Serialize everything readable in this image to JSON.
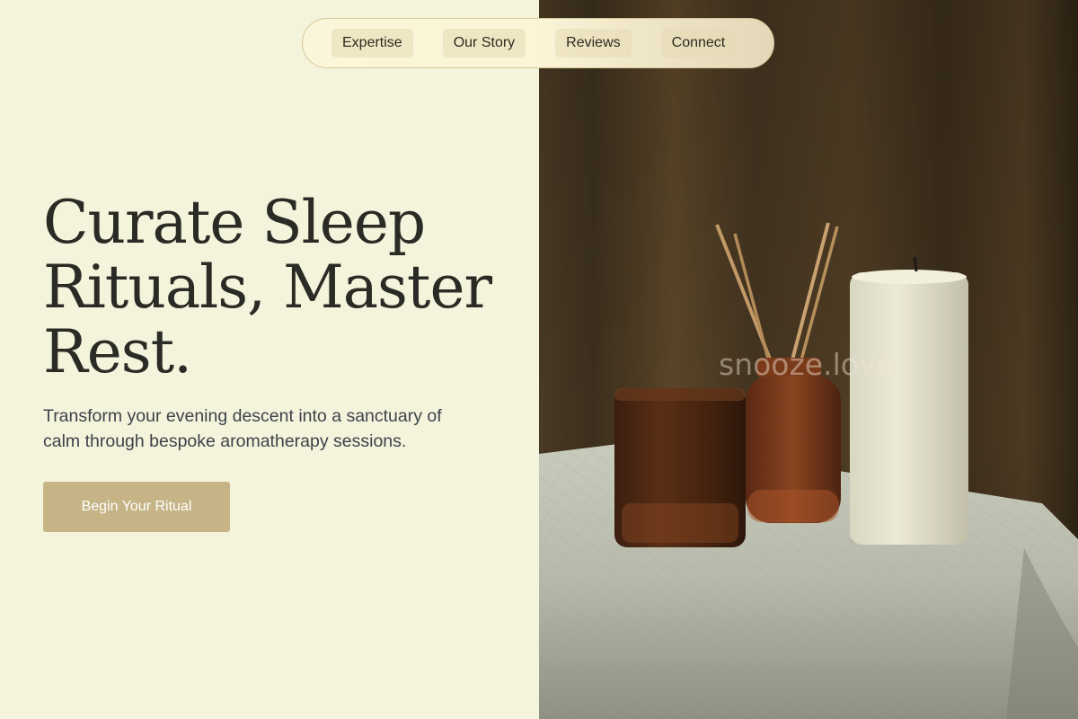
{
  "nav": {
    "items": [
      {
        "label": "Expertise"
      },
      {
        "label": "Our Story"
      },
      {
        "label": "Reviews"
      },
      {
        "label": "Connect"
      }
    ]
  },
  "hero": {
    "title_lines": [
      "Curate Sleep",
      "Rituals, Master",
      "Rest."
    ],
    "subtitle_lines": [
      "Transform your evening descent into a sanctuary of",
      "calm through bespoke aromatherapy sessions."
    ],
    "cta_label": "Begin Your Ritual"
  },
  "watermark": "snooze.love",
  "colors": {
    "background": "#f4f4dc",
    "accent": "#c6b486",
    "heading": "#2b2b26",
    "body_text": "#3e424a"
  }
}
